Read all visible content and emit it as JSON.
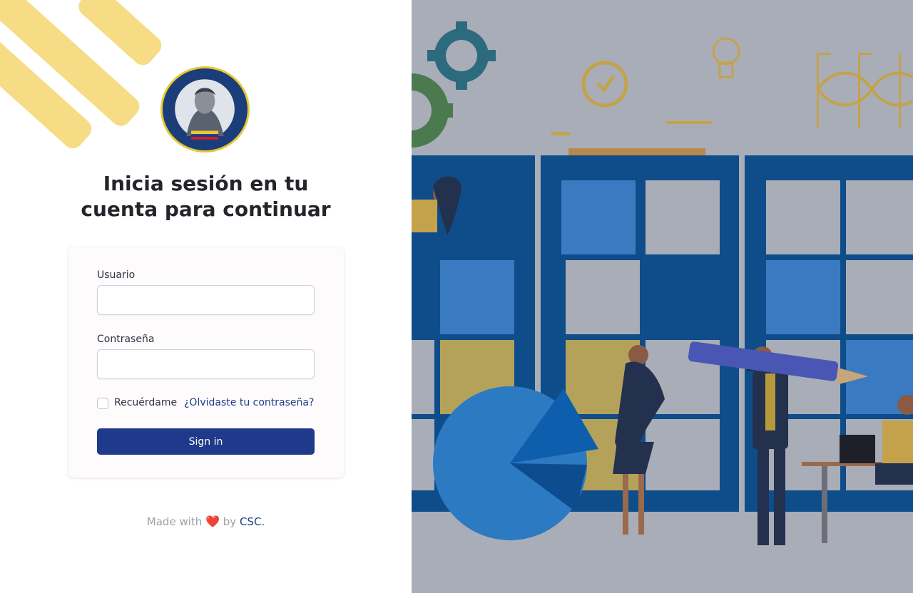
{
  "brand": {
    "logo_alt": "Universidad Bolivariana de Venezuela",
    "accent_color": "#f5dc85",
    "primary_color": "#1f3a8a"
  },
  "login": {
    "heading_line1": "Inicia sesión en tu",
    "heading_line2": "cuenta para continuar",
    "username_label": "Usuario",
    "username_value": "",
    "password_label": "Contraseña",
    "password_value": "",
    "remember_label": "Recuérdame",
    "remember_checked": false,
    "forgot_link": "¿Olvidaste tu contraseña?",
    "submit_label": "Sign in"
  },
  "footer": {
    "made_with": "Made with",
    "heart": "❤️",
    "by": "by",
    "author": "CSC."
  },
  "illustration": {
    "description_icon_names": [
      "gear-icon",
      "clock-icon",
      "lightbulb-icon",
      "infinity-icon",
      "pencil-icon",
      "pie-chart-icon"
    ]
  }
}
